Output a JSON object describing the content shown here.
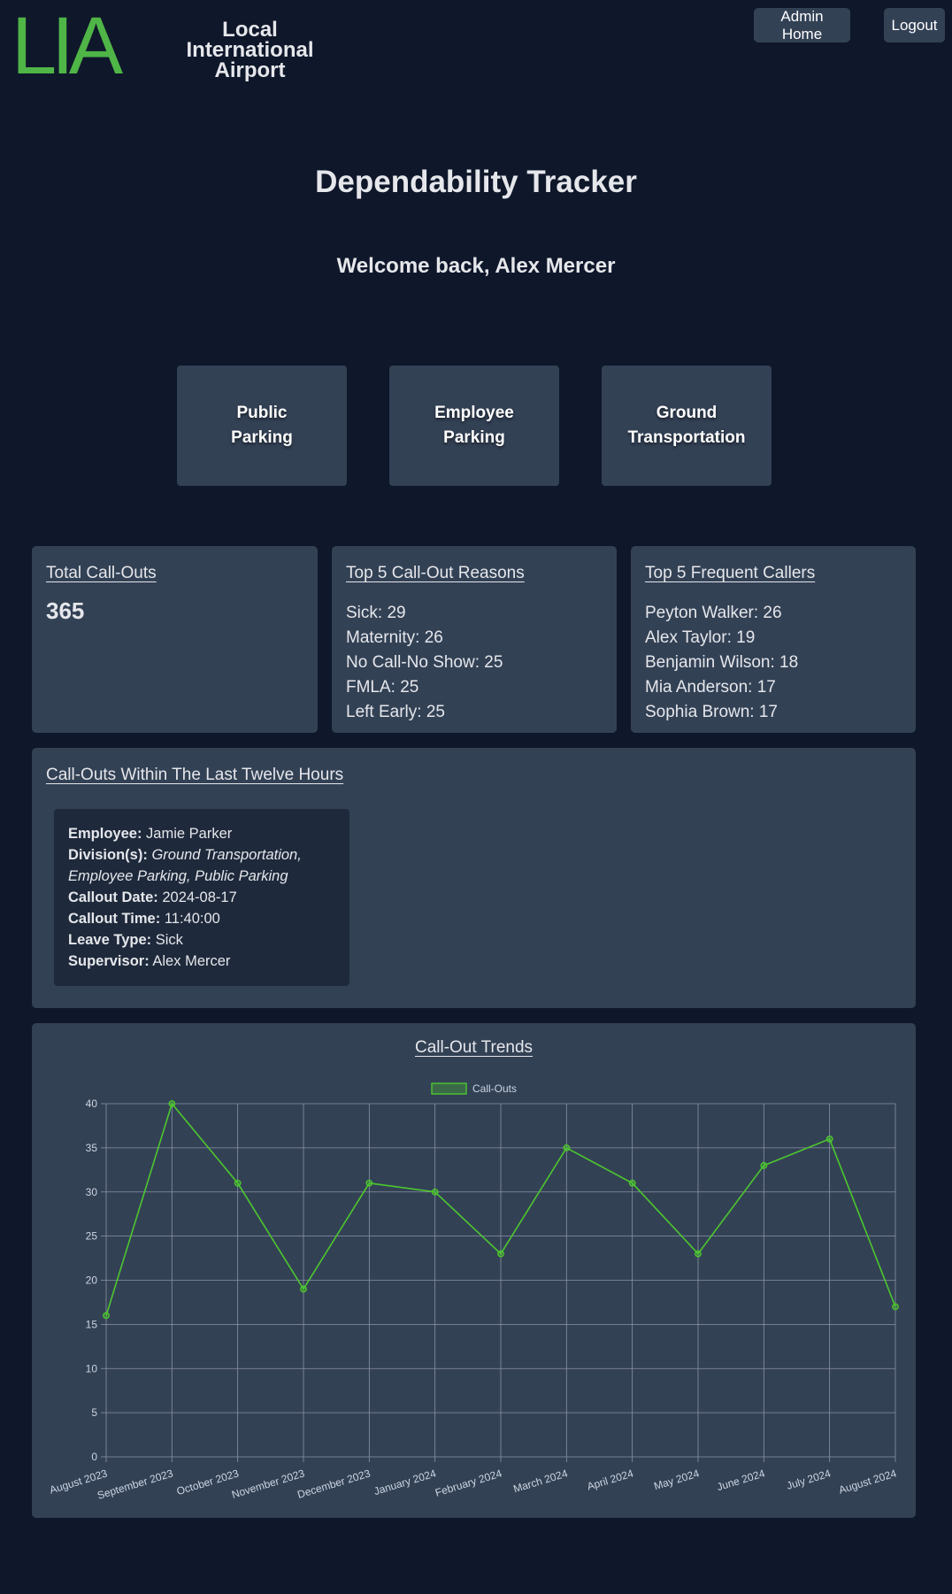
{
  "header": {
    "logo_mark": "LIA",
    "logo_line1": "Local",
    "logo_line2": "International",
    "logo_line3": "Airport",
    "admin_home_label": "Admin Home",
    "logout_label": "Logout"
  },
  "page": {
    "title": "Dependability Tracker",
    "welcome": "Welcome back, Alex Mercer"
  },
  "departments": [
    {
      "line1": "Public",
      "line2": "Parking"
    },
    {
      "line1": "Employee",
      "line2": "Parking"
    },
    {
      "line1": "Ground",
      "line2": "Transportation"
    }
  ],
  "total_callouts": {
    "title": "Total Call-Outs",
    "value": "365"
  },
  "top_reasons": {
    "title": "Top 5 Call-Out Reasons",
    "items": [
      "Sick: 29",
      "Maternity: 26",
      "No Call-No Show: 25",
      "FMLA: 25",
      "Left Early: 25"
    ]
  },
  "top_callers": {
    "title": "Top 5 Frequent Callers",
    "items": [
      "Peyton Walker: 26",
      "Alex Taylor: 19",
      "Benjamin Wilson: 18",
      "Mia Anderson: 17",
      "Sophia Brown: 17"
    ]
  },
  "recent": {
    "title": "Call-Outs Within The Last Twelve Hours",
    "employee_label": "Employee:",
    "employee": "Jamie Parker",
    "division_label": "Division(s):",
    "division_line1": "Ground Transportation,",
    "division_line2": "Employee Parking, Public Parking",
    "date_label": "Callout Date:",
    "date": "2024-08-17",
    "time_label": "Callout Time:",
    "time": "11:40:00",
    "leave_label": "Leave Type:",
    "leave": "Sick",
    "supervisor_label": "Supervisor:",
    "supervisor": "Alex Mercer"
  },
  "chart_data": {
    "type": "line",
    "title": "Call-Out Trends",
    "categories": [
      "August 2023",
      "September 2023",
      "October 2023",
      "November 2023",
      "December 2023",
      "January 2024",
      "February 2024",
      "March 2024",
      "April 2024",
      "May 2024",
      "June 2024",
      "July 2024",
      "August 2024"
    ],
    "series": [
      {
        "name": "Call-Outs",
        "values": [
          16,
          40,
          31,
          19,
          31,
          30,
          23,
          35,
          31,
          23,
          33,
          36,
          17
        ]
      }
    ],
    "ylim": [
      0,
      40
    ],
    "yticks": [
      0,
      5,
      10,
      15,
      20,
      25,
      30,
      35,
      40
    ],
    "grid": true,
    "legend": "top-center",
    "line_color": "#4cc72e"
  },
  "colors": {
    "background": "#0f172a",
    "panel": "#334155",
    "card": "#1e293b",
    "brand": "#4fb547"
  }
}
